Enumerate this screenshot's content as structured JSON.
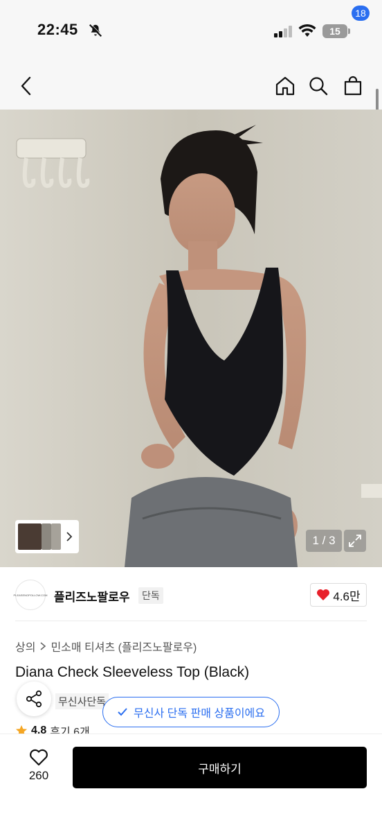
{
  "status_bar": {
    "time": "22:45",
    "battery": "15",
    "icons": [
      "bell-slash-icon",
      "signal-icon",
      "wifi-icon",
      "battery-icon"
    ]
  },
  "nav": {
    "cart_count": "18",
    "icons": [
      "back-chevron-icon",
      "home-icon",
      "search-icon",
      "shopping-bag-icon"
    ]
  },
  "gallery": {
    "page_counter": "1 / 3",
    "icons": [
      "chevron-right-icon",
      "expand-icon"
    ]
  },
  "brand": {
    "logo_text": "PLEASENOPOLLOW.COM",
    "name": "플리즈노팔로우",
    "exclusive_tag": "단독",
    "likes": "4.6만"
  },
  "product": {
    "breadcrumb": [
      "상의",
      "민소매 티셔츠 (플리즈노팔로우)"
    ],
    "title": "Diana Check Sleeveless Top (Black)",
    "badge": "무신사단독",
    "tooltip": "무신사 단독 판매 상품이에요",
    "rating": "4.8",
    "reviews": "후기 6개"
  },
  "bottom": {
    "like_count": "260",
    "buy_label": "구매하기"
  },
  "colors": {
    "accent": "#2a6ef0",
    "buy": "#000000",
    "heart": "#e8202a",
    "star": "#f5a623"
  }
}
